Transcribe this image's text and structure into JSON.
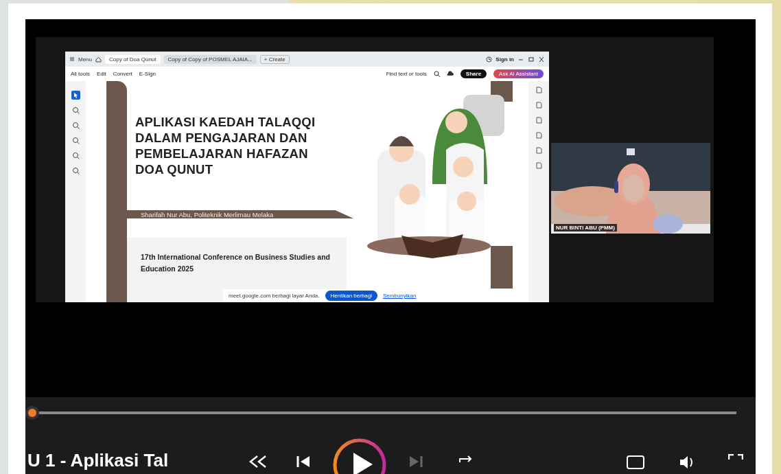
{
  "meeting": {
    "browser": {
      "menu_label": "Menu",
      "tabs": [
        {
          "label": "Copy of Doa Qunut",
          "selected": true
        },
        {
          "label": "Copy of Copy of POSMEL AJAIA...",
          "selected": false
        }
      ],
      "new_tab": "+ Create",
      "sign_in": "Sign in",
      "toolbar": [
        "All tools",
        "Edit",
        "Convert",
        "E-Sign"
      ],
      "find": "Find text or tools",
      "share": "Share",
      "ai_button": "Ask AI Assistant"
    },
    "slide": {
      "title": "APLIKASI KAEDAH TALAQQI DALAM PENGAJARAN DAN PEMBELAJARAN HAFAZAN DOA QUNUT",
      "author": "Sharifah Nur Abu, Politeknik Merlimau Melaka",
      "conference": "17th International Conference on Business Studies and Education 2025"
    },
    "share_bar": {
      "message": "meet.google.com berbagi layar Anda.",
      "stop": "Hentikan berbagi",
      "hide": "Sembunyikan"
    },
    "participant": {
      "name": "NUR BINTI ABU (PMM)"
    }
  },
  "player": {
    "progress": {
      "level": 0
    },
    "title": "U 1 - Aplikasi Tal",
    "playing": false
  }
}
